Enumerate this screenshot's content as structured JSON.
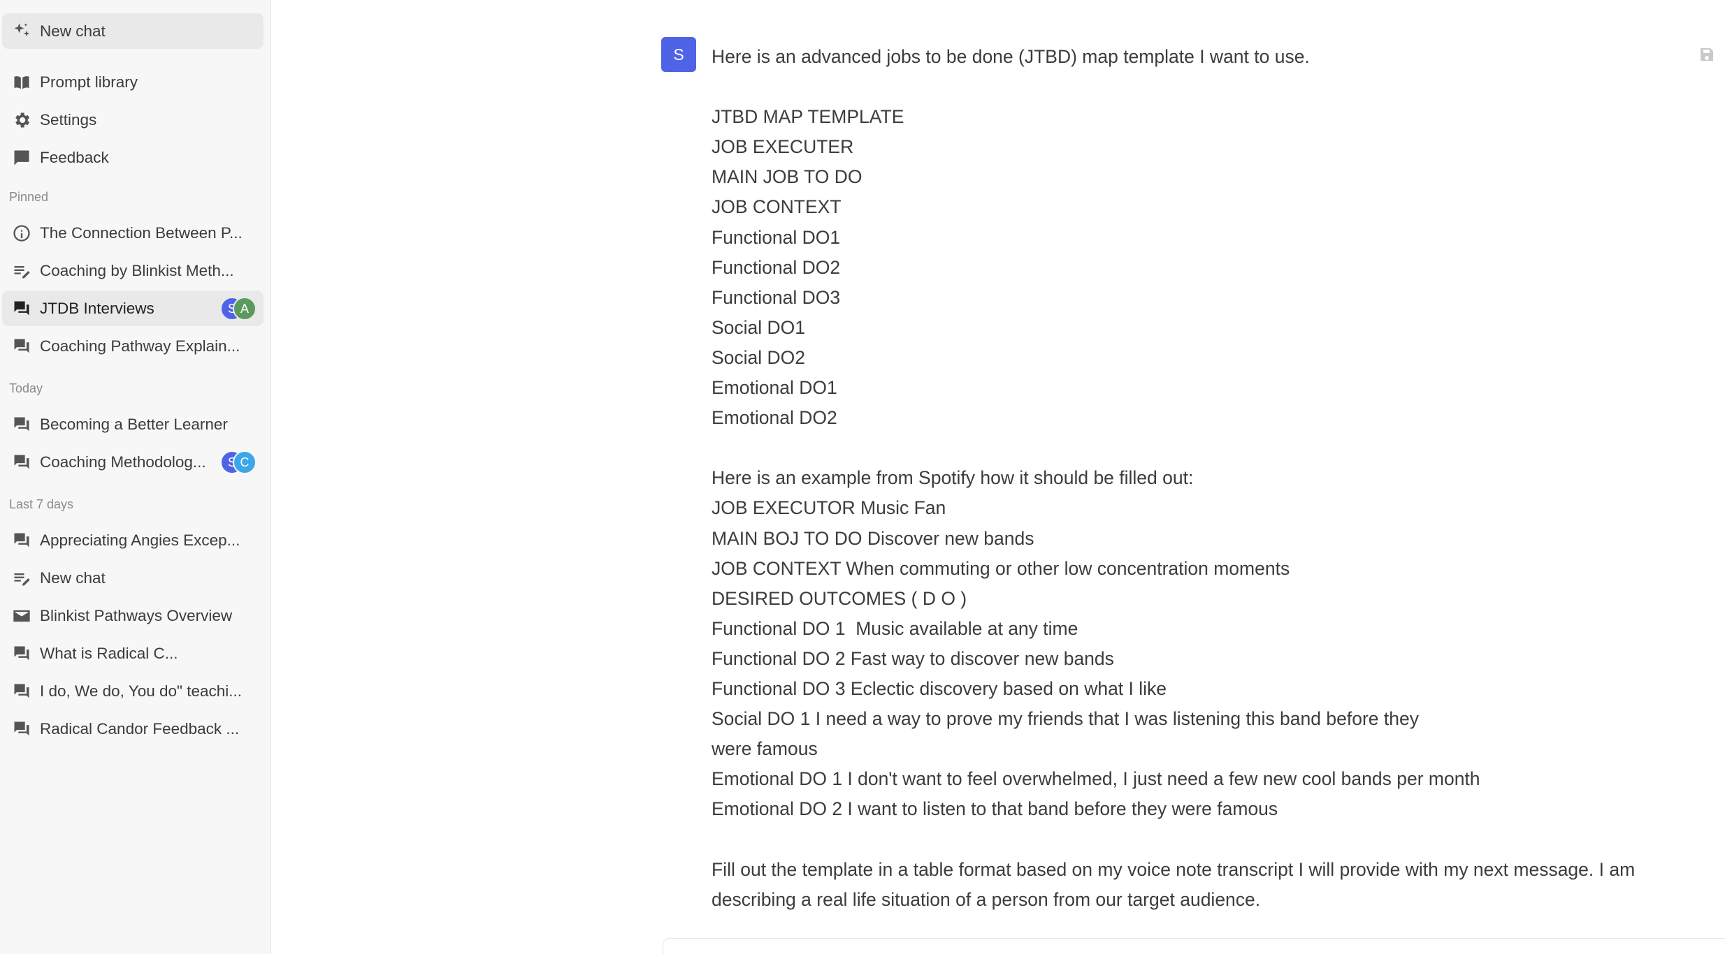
{
  "sidebar": {
    "new_chat": "New chat",
    "prompt_library": "Prompt library",
    "settings": "Settings",
    "feedback": "Feedback",
    "sections": {
      "pinned": "Pinned",
      "today": "Today",
      "last7": "Last 7 days"
    },
    "pinned": [
      {
        "label": "The Connection Between P...",
        "icon": "info-icon"
      },
      {
        "label": "Coaching by Blinkist Meth...",
        "icon": "edit-list-icon"
      },
      {
        "label": "JTDB Interviews",
        "icon": "chat-icon",
        "avatars": [
          "S",
          "A"
        ]
      },
      {
        "label": "Coaching Pathway Explain...",
        "icon": "chat-icon"
      }
    ],
    "today": [
      {
        "label": "Becoming a Better Learner",
        "icon": "chat-icon"
      },
      {
        "label": "Coaching Methodolog...",
        "icon": "chat-icon",
        "avatars": [
          "S",
          "C"
        ]
      }
    ],
    "last7": [
      {
        "label": "Appreciating Angies Excep...",
        "icon": "chat-icon"
      },
      {
        "label": "New chat",
        "icon": "edit-list-icon"
      },
      {
        "label": "Blinkist Pathways Overview",
        "icon": "mail-icon"
      },
      {
        "label": "What is Radical C...",
        "icon": "chat-icon"
      },
      {
        "label": "I do, We do, You do\" teachi...",
        "icon": "chat-icon"
      },
      {
        "label": "Radical Candor Feedback ...",
        "icon": "chat-icon"
      }
    ]
  },
  "message": {
    "avatar": "S",
    "lines": [
      "Here is an advanced jobs to be done (JTBD) map template I want to use.",
      "",
      "JTBD MAP TEMPLATE",
      "JOB EXECUTER",
      "MAIN JOB TO DO",
      "JOB CONTEXT",
      "Functional DO1",
      "Functional DO2",
      "Functional DO3",
      "Social DO1",
      "Social DO2",
      "Emotional DO1",
      "Emotional DO2",
      "",
      "Here is an example from Spotify how it should be filled out:",
      "JOB EXECUTOR Music Fan",
      "MAIN BOJ TO DO Discover new bands",
      "JOB CONTEXT When commuting or other low concentration moments",
      "DESIRED OUTCOMES ( D O )",
      "Functional DO 1  Music available at any time",
      "Functional DO 2 Fast way to discover new bands",
      "Functional DO 3 Eclectic discovery based on what I like",
      "Social DO 1 I need a way to prove my friends that I was listening this band before they",
      "were famous",
      "Emotional DO 1 I don't want to feel overwhelmed, I just need a few new cool bands per month",
      "Emotional DO 2 I want to listen to that band before they were famous",
      "",
      "Fill out the template in a table format based on my voice note transcript I will provide with my next message. I am",
      "describing a real life situation of a person from our target audience."
    ]
  },
  "colors": {
    "avatar_blue": "#4f63e6",
    "avatar_green": "#5a9a5c",
    "avatar_lightblue": "#3aa7e8"
  }
}
